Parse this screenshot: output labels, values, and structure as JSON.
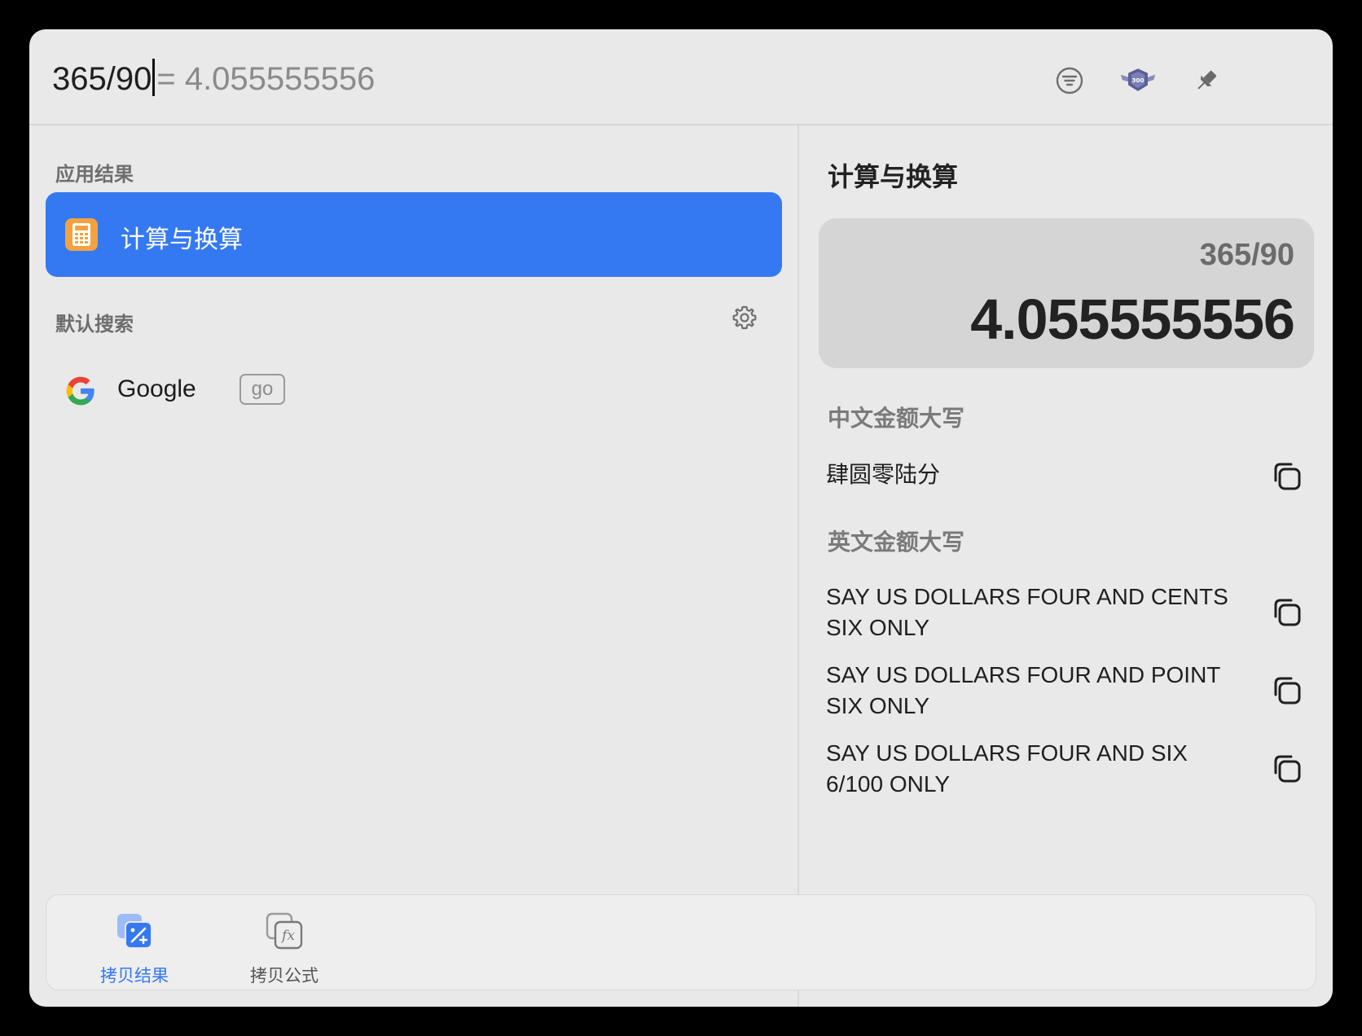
{
  "search": {
    "query": "365/90",
    "inline_result": "= 4.055555556"
  },
  "toolbar": {
    "filter_icon": "filter-list-icon",
    "badge_icon": "300-badge-icon",
    "badge_text": "300",
    "pin_icon": "pin-icon"
  },
  "left": {
    "app_results_label": "应用结果",
    "app_item": {
      "label": "计算与换算",
      "icon": "calculator-icon"
    },
    "default_search_label": "默认搜索",
    "default_search_item": {
      "label": "Google",
      "badge": "go",
      "icon": "google-icon"
    }
  },
  "right": {
    "title": "计算与换算",
    "expression": "365/90",
    "result": "4.055555556",
    "cn_label": "中文金额大写",
    "cn_value": "肆圆零陆分",
    "en_label": "英文金额大写",
    "en_values": [
      "SAY US DOLLARS FOUR AND CENTS SIX ONLY",
      "SAY US DOLLARS FOUR AND POINT SIX ONLY",
      "SAY US DOLLARS FOUR AND SIX 6/100 ONLY"
    ]
  },
  "bottom": {
    "actions": [
      {
        "label": "拷贝结果",
        "color": "#3479f1",
        "icon": "copy-result-icon"
      },
      {
        "label": "拷贝公式",
        "color": "#555555",
        "icon": "copy-formula-icon"
      }
    ]
  },
  "colors": {
    "accent": "#3479f1",
    "calculator": "#f4a240"
  }
}
